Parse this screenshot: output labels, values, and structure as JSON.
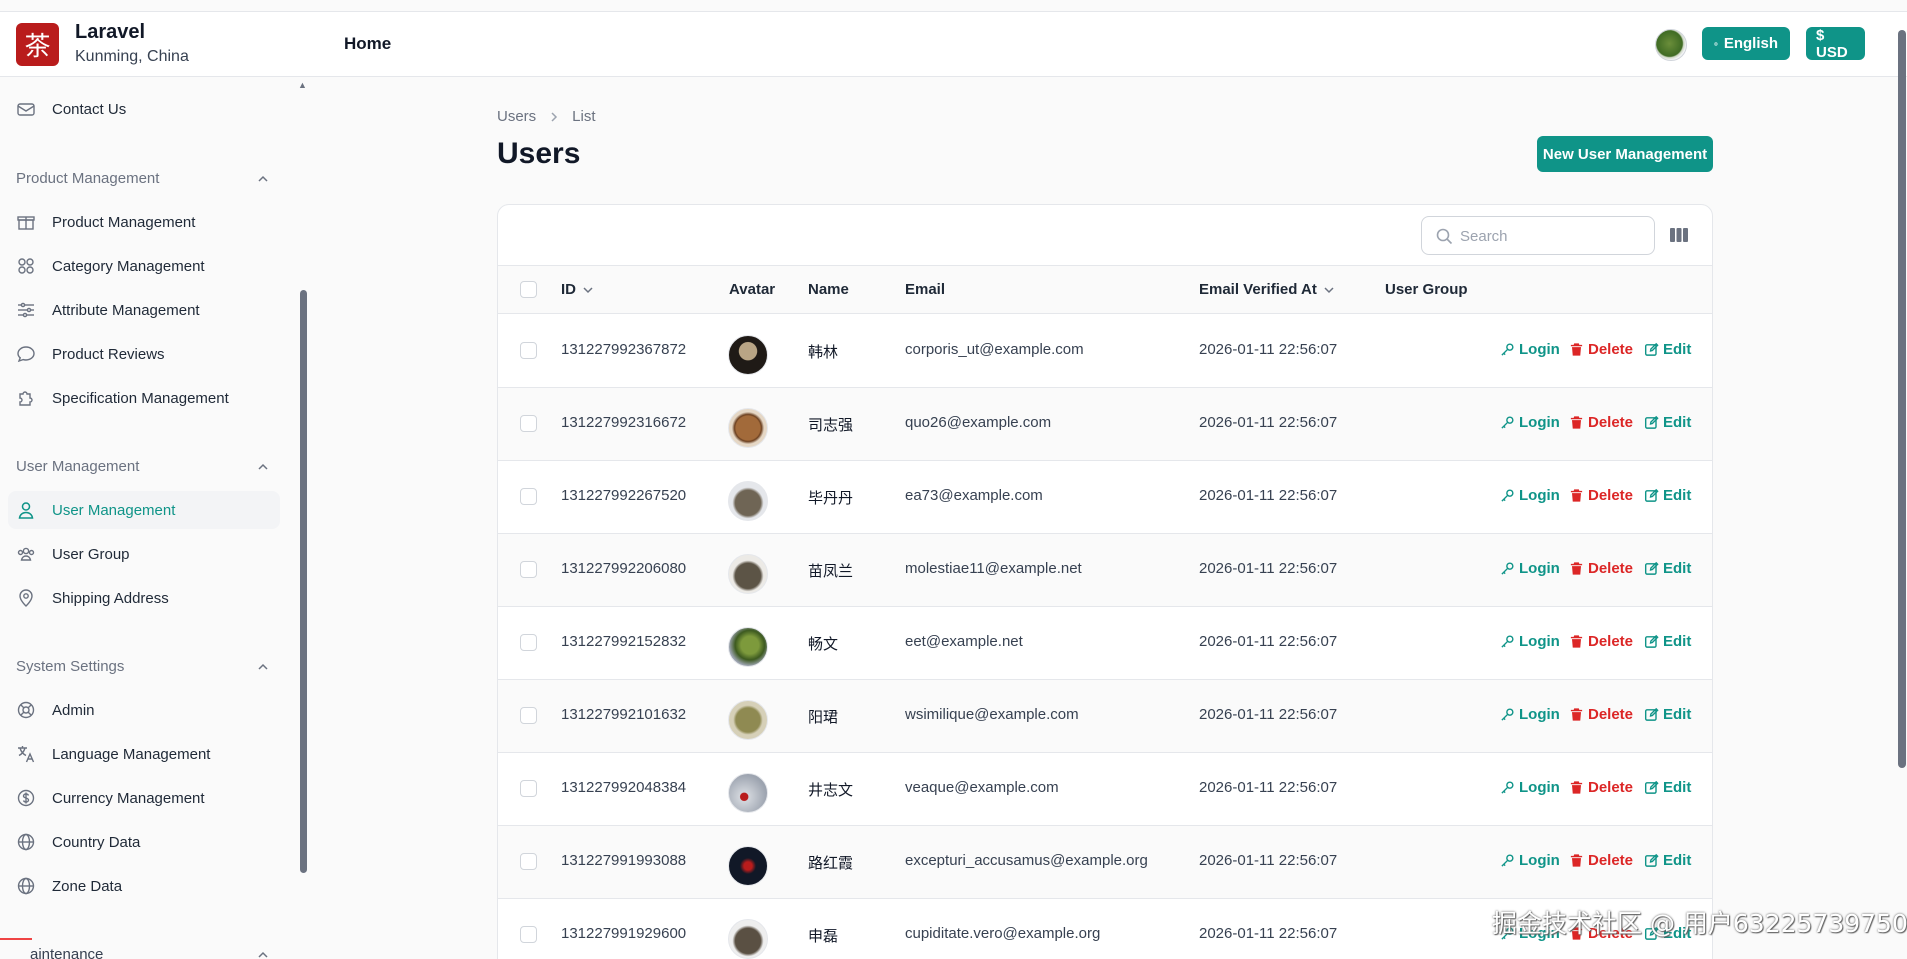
{
  "brand": {
    "logo_char": "茶",
    "name": "Laravel",
    "location": "Kunming, China"
  },
  "topbar": {
    "home_label": "Home",
    "language_label": "English",
    "currency_label": "$ USD"
  },
  "sidebar": {
    "contact": {
      "label": "Contact Us",
      "icon": "envelope-icon"
    },
    "groups": [
      {
        "label": "Product Management",
        "items": [
          {
            "label": "Product Management",
            "icon": "gift-icon"
          },
          {
            "label": "Category Management",
            "icon": "grid-icon"
          },
          {
            "label": "Attribute Management",
            "icon": "sliders-icon"
          },
          {
            "label": "Product Reviews",
            "icon": "chat-bubble-icon"
          },
          {
            "label": "Specification Management",
            "icon": "puzzle-icon"
          }
        ]
      },
      {
        "label": "User Management",
        "items": [
          {
            "label": "User Management",
            "icon": "user-icon",
            "active": true
          },
          {
            "label": "User Group",
            "icon": "users-icon"
          },
          {
            "label": "Shipping Address",
            "icon": "map-pin-icon"
          }
        ]
      },
      {
        "label": "System Settings",
        "items": [
          {
            "label": "Admin",
            "icon": "lifebuoy-icon"
          },
          {
            "label": "Language Management",
            "icon": "translate-icon"
          },
          {
            "label": "Currency Management",
            "icon": "dollar-circle-icon"
          },
          {
            "label": "Country Data",
            "icon": "globe-icon"
          },
          {
            "label": "Zone Data",
            "icon": "globe-icon"
          }
        ]
      },
      {
        "label": "aintenance"
      }
    ]
  },
  "breadcrumb": {
    "parent": "Users",
    "current": "List"
  },
  "page": {
    "title": "Users",
    "new_button": "New User Management"
  },
  "search": {
    "placeholder": "Search"
  },
  "table": {
    "headers": {
      "id": "ID",
      "avatar": "Avatar",
      "name": "Name",
      "email": "Email",
      "verified": "Email Verified At",
      "group": "User Group"
    },
    "actions": {
      "login": "Login",
      "delete": "Delete",
      "edit": "Edit"
    },
    "rows": [
      {
        "id": "131227992367872",
        "name": "韩林",
        "email": "corporis_ut@example.com",
        "verified": "2026-01-11 22:56:07",
        "group": ""
      },
      {
        "id": "131227992316672",
        "name": "司志强",
        "email": "quo26@example.com",
        "verified": "2026-01-11 22:56:07",
        "group": ""
      },
      {
        "id": "131227992267520",
        "name": "毕丹丹",
        "email": "ea73@example.com",
        "verified": "2026-01-11 22:56:07",
        "group": ""
      },
      {
        "id": "131227992206080",
        "name": "苗凤兰",
        "email": "molestiae11@example.net",
        "verified": "2026-01-11 22:56:07",
        "group": ""
      },
      {
        "id": "131227992152832",
        "name": "畅文",
        "email": "eet@example.net",
        "verified": "2026-01-11 22:56:07",
        "group": ""
      },
      {
        "id": "131227992101632",
        "name": "阳珺",
        "email": "wsimilique@example.com",
        "verified": "2026-01-11 22:56:07",
        "group": ""
      },
      {
        "id": "131227992048384",
        "name": "井志文",
        "email": "veaque@example.com",
        "verified": "2026-01-11 22:56:07",
        "group": ""
      },
      {
        "id": "131227991993088",
        "name": "路红霞",
        "email": "excepturi_accusamus@example.org",
        "verified": "2026-01-11 22:56:07",
        "group": ""
      },
      {
        "id": "131227991929600",
        "name": "申磊",
        "email": "cupiditate.vero@example.org",
        "verified": "2026-01-11 22:56:07",
        "group": ""
      }
    ]
  },
  "watermark": "掘金技术社区 @ 用户63225739750",
  "colors": {
    "accent": "#0f9488",
    "danger": "#dc2626",
    "logo": "#b91c1c"
  }
}
